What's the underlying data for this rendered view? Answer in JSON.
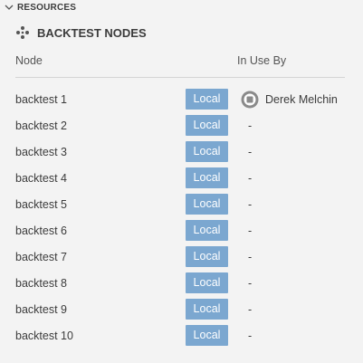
{
  "section": {
    "title": "RESOURCES",
    "icon": "chevron-down-icon"
  },
  "panel": {
    "title": "BACKTEST NODES",
    "icon": "nodes-icon"
  },
  "columns": {
    "node": "Node",
    "in_use_by": "In Use By"
  },
  "colors": {
    "badge_bg": "#7ba7d0",
    "badge_text": "#ffffff",
    "background": "#f3f3f3"
  },
  "rows": [
    {
      "name": "backtest 1",
      "badge": "Local",
      "in_use_by": "Derek Melchin",
      "user_icon": "stop-icon"
    },
    {
      "name": "backtest 2",
      "badge": "Local",
      "in_use_by": "-"
    },
    {
      "name": "backtest 3",
      "badge": "Local",
      "in_use_by": "-"
    },
    {
      "name": "backtest 4",
      "badge": "Local",
      "in_use_by": "-"
    },
    {
      "name": "backtest 5",
      "badge": "Local",
      "in_use_by": "-"
    },
    {
      "name": "backtest 6",
      "badge": "Local",
      "in_use_by": "-"
    },
    {
      "name": "backtest 7",
      "badge": "Local",
      "in_use_by": "-"
    },
    {
      "name": "backtest 8",
      "badge": "Local",
      "in_use_by": "-"
    },
    {
      "name": "backtest 9",
      "badge": "Local",
      "in_use_by": "-"
    },
    {
      "name": "backtest 10",
      "badge": "Local",
      "in_use_by": "-"
    }
  ]
}
